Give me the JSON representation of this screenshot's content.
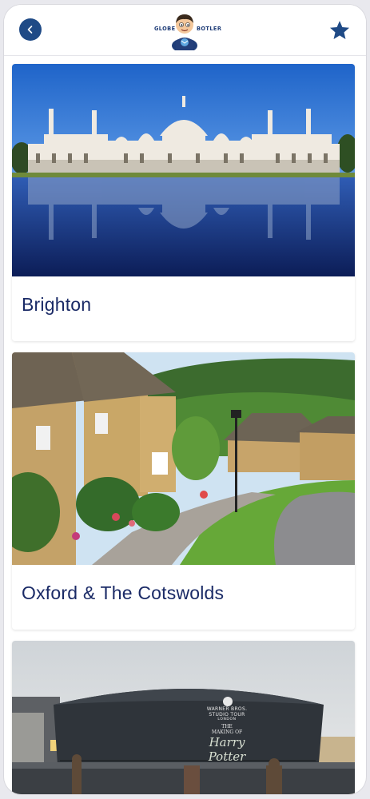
{
  "header": {
    "back_icon": "back-arrow-icon",
    "logo_left": "GLOBE",
    "logo_right": "BOTLER",
    "favorite_icon": "star-icon",
    "accent_color": "#1f4a86"
  },
  "cards": [
    {
      "title": "Brighton",
      "image": "brighton-pavilion-reflection"
    },
    {
      "title": "Oxford & The Cotswolds",
      "image": "cotswolds-village-street"
    },
    {
      "title": "",
      "image": "harry-potter-studio-tour-building",
      "sign": {
        "line1": "WARNER BROS.",
        "line2": "STUDIO TOUR",
        "line3": "LONDON",
        "line4": "THE",
        "line5": "MAKING OF",
        "line6": "Harry Potter"
      }
    }
  ]
}
